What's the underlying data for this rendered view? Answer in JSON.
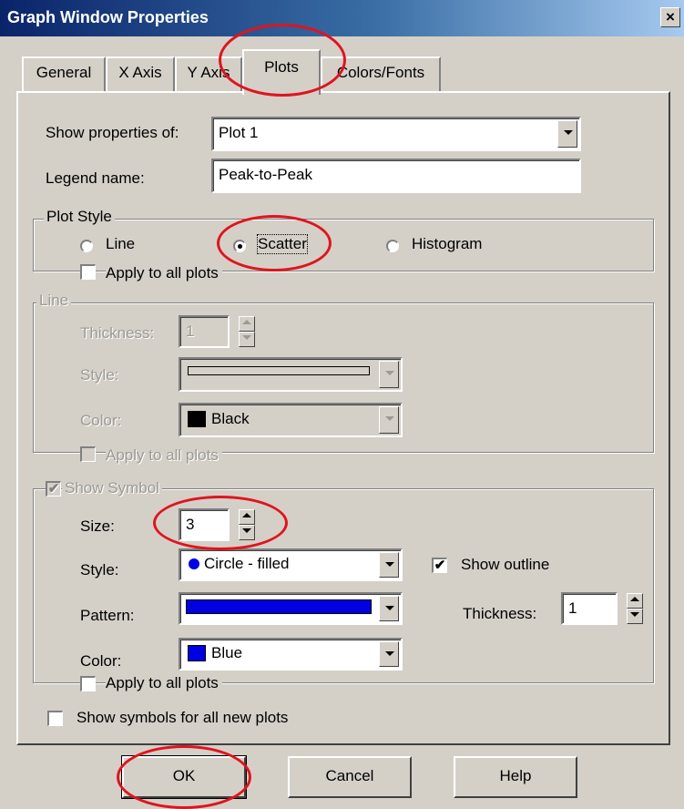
{
  "window": {
    "title": "Graph Window Properties",
    "close_glyph": "×"
  },
  "tabs": [
    {
      "label": "General"
    },
    {
      "label": "X Axis"
    },
    {
      "label": "Y Axis"
    },
    {
      "label": "Plots"
    },
    {
      "label": "Colors/Fonts"
    }
  ],
  "active_tab": "Plots",
  "show_properties": {
    "label": "Show properties of:",
    "value": "Plot 1"
  },
  "legend_name": {
    "label": "Legend name:",
    "value": "Peak-to-Peak"
  },
  "plot_style": {
    "title": "Plot Style",
    "options": [
      "Line",
      "Scatter",
      "Histogram"
    ],
    "selected": "Scatter",
    "apply_all": "Apply to all plots"
  },
  "line": {
    "title": "Line",
    "thickness_label": "Thickness:",
    "thickness_value": "1",
    "style_label": "Style:",
    "color_label": "Color:",
    "color_value": "Black",
    "color_hex": "#000000",
    "apply_all": "Apply to all plots"
  },
  "symbol": {
    "title": "Show Symbol",
    "show_checked": true,
    "size_label": "Size:",
    "size_value": "3",
    "style_label": "Style:",
    "style_value": "Circle - filled",
    "show_outline_label": "Show outline",
    "show_outline_checked": true,
    "pattern_label": "Pattern:",
    "pattern_hex": "#0000e0",
    "thickness_label": "Thickness:",
    "thickness_value": "1",
    "color_label": "Color:",
    "color_value": "Blue",
    "color_hex": "#0000e0",
    "apply_all": "Apply to all plots"
  },
  "show_symbols_all": {
    "label": "Show symbols for all new plots",
    "checked": false
  },
  "buttons": {
    "ok": "OK",
    "cancel": "Cancel",
    "help": "Help"
  },
  "annotation_color": "#e0141e"
}
